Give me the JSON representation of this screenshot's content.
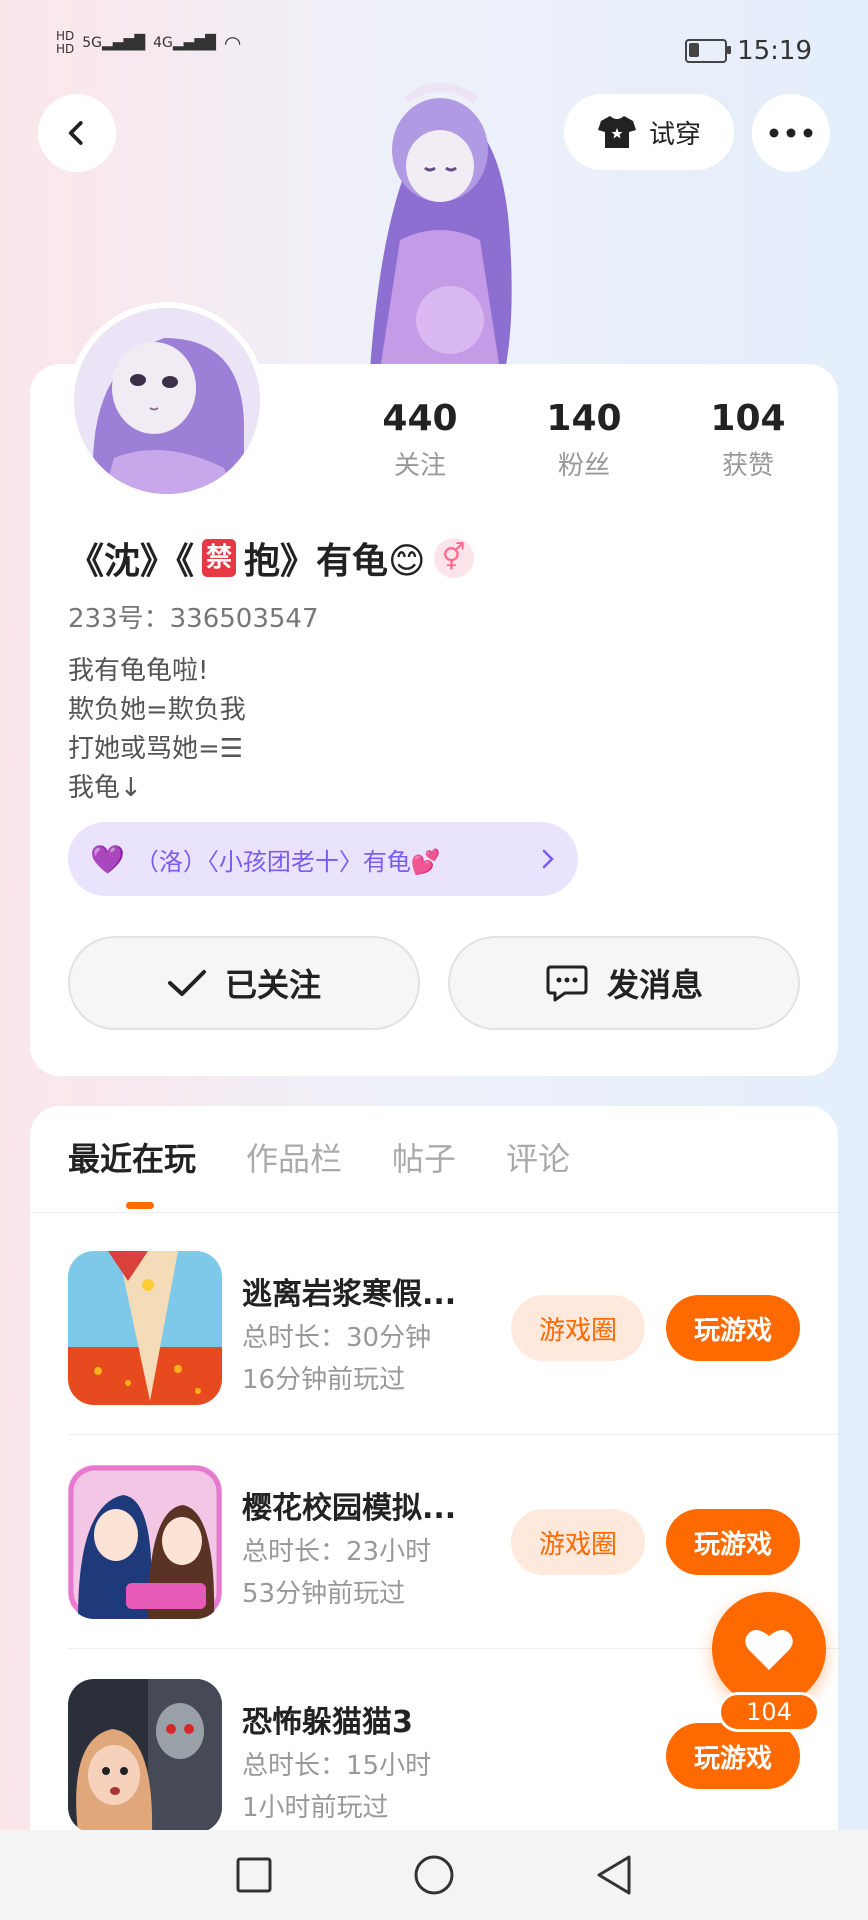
{
  "status_bar": {
    "time": "15:19",
    "network_left": "HD 5G",
    "network_right": "HD 4G",
    "battery_level": 0.3
  },
  "top_nav": {
    "try_on_label": "试穿"
  },
  "profile": {
    "stats": [
      {
        "value": "440",
        "label": "关注"
      },
      {
        "value": "140",
        "label": "粉丝"
      },
      {
        "value": "104",
        "label": "获赞"
      }
    ],
    "name_part1": "《沈》《",
    "name_ban": "禁",
    "name_part2": "抱》有龟😊",
    "gender_symbol": "⚥",
    "uid": "233号：336503547",
    "bio": "我有龟龟啦!\n欺负她=欺负我\n打她或骂她=☰\n我龟↓",
    "relation_text": "（洛）〈小孩团老十〉有龟💕",
    "follow_button": "已关注",
    "message_button": "发消息"
  },
  "tabs": [
    "最近在玩",
    "作品栏",
    "帖子",
    "评论"
  ],
  "games": [
    {
      "name": "逃离岩浆寒假...",
      "duration": "总时长：30分钟",
      "last_played": "16分钟前玩过",
      "circle_label": "游戏圈",
      "play_label": "玩游戏"
    },
    {
      "name": "樱花校园模拟...",
      "duration": "总时长：23小时",
      "last_played": "53分钟前玩过",
      "circle_label": "游戏圈",
      "play_label": "玩游戏"
    },
    {
      "name": "恐怖躲猫猫3",
      "duration": "总时长：15小时",
      "last_played": "1小时前玩过",
      "circle_label": "",
      "play_label": "玩游戏"
    }
  ],
  "like_fab": {
    "count": "104"
  },
  "colors": {
    "accent": "#ff6a00",
    "accent_light": "#ffe8dc",
    "relation_bg": "#e9e3fd",
    "relation_text": "#7a5cf0"
  }
}
